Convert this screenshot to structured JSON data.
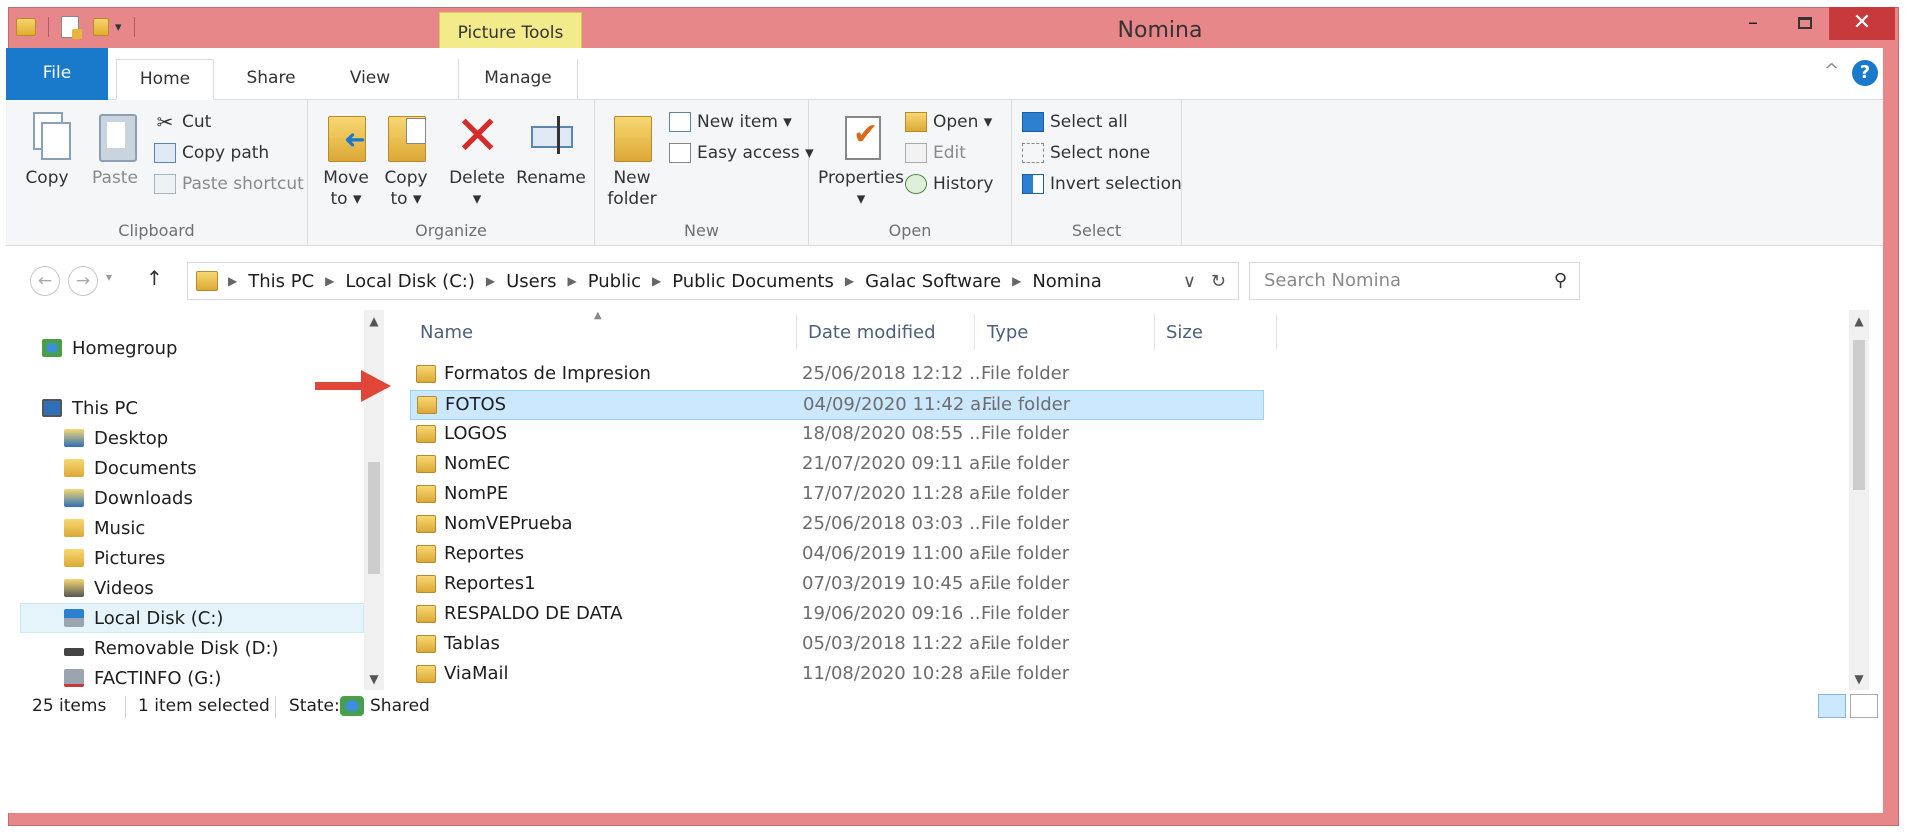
{
  "window": {
    "title": "Nomina",
    "context_tab": "Picture Tools",
    "controls": {
      "minimize": "–",
      "maximize": "□",
      "close": "✕"
    }
  },
  "ribbon": {
    "tabs": [
      "File",
      "Home",
      "Share",
      "View",
      "Manage"
    ],
    "active_tab": "Home",
    "help": "?",
    "collapse": "^",
    "groups": {
      "clipboard": {
        "label": "Clipboard",
        "copy": "Copy",
        "paste": "Paste",
        "cut": "Cut",
        "copy_path": "Copy path",
        "paste_shortcut": "Paste shortcut"
      },
      "organize": {
        "label": "Organize",
        "move_to": [
          "Move",
          "to ▾"
        ],
        "copy_to": [
          "Copy",
          "to ▾"
        ],
        "delete": "Delete",
        "delete_caret": "▾",
        "rename": "Rename"
      },
      "new": {
        "label": "New",
        "new_folder": [
          "New",
          "folder"
        ],
        "new_item": "New item ▾",
        "easy_access": "Easy access ▾"
      },
      "open": {
        "label": "Open",
        "properties": "Properties",
        "properties_caret": "▾",
        "open": "Open ▾",
        "edit": "Edit",
        "history": "History"
      },
      "select": {
        "label": "Select",
        "select_all": "Select all",
        "select_none": "Select none",
        "invert_selection": "Invert selection"
      }
    }
  },
  "address": {
    "back": "←",
    "forward": "→",
    "recent": "▾",
    "up": "↑",
    "crumbs": [
      "This PC",
      "Local Disk (C:)",
      "Users",
      "Public",
      "Public Documents",
      "Galac Software",
      "Nomina"
    ],
    "separator": "▶",
    "dropdown": "∨",
    "refresh": "↻",
    "search_placeholder": "Search Nomina",
    "search_icon": "⚲"
  },
  "nav_pane": {
    "items": [
      {
        "label": "Homegroup",
        "icon": "homegroup-icon"
      },
      {
        "label": "This PC",
        "icon": "computer-icon"
      },
      {
        "label": "Desktop",
        "icon": "desktop-icon"
      },
      {
        "label": "Documents",
        "icon": "documents-icon"
      },
      {
        "label": "Downloads",
        "icon": "downloads-icon"
      },
      {
        "label": "Music",
        "icon": "music-icon"
      },
      {
        "label": "Pictures",
        "icon": "pictures-icon"
      },
      {
        "label": "Videos",
        "icon": "videos-icon"
      },
      {
        "label": "Local Disk (C:)",
        "icon": "drive-icon"
      },
      {
        "label": "Removable Disk (D:)",
        "icon": "removable-drive-icon"
      },
      {
        "label": "FACTINFO (G:)",
        "icon": "network-drive-icon"
      }
    ],
    "selected": "Local Disk (C:)"
  },
  "file_list": {
    "columns": {
      "name": "Name",
      "date": "Date modified",
      "type": "Type",
      "size": "Size"
    },
    "sort_indicator": "▲",
    "rows": [
      {
        "name": "Formatos de Impresion",
        "date": "25/06/2018 12:12 ...",
        "type": "File folder"
      },
      {
        "name": "FOTOS",
        "date": "04/09/2020 11:42 a...",
        "type": "File folder"
      },
      {
        "name": "LOGOS",
        "date": "18/08/2020 08:55 ...",
        "type": "File folder"
      },
      {
        "name": "NomEC",
        "date": "21/07/2020 09:11 a...",
        "type": "File folder"
      },
      {
        "name": "NomPE",
        "date": "17/07/2020 11:28 a...",
        "type": "File folder"
      },
      {
        "name": "NomVEPrueba",
        "date": "25/06/2018 03:03 ...",
        "type": "File folder"
      },
      {
        "name": "Reportes",
        "date": "04/06/2019 11:00 a...",
        "type": "File folder"
      },
      {
        "name": "Reportes1",
        "date": "07/03/2019 10:45 a...",
        "type": "File folder"
      },
      {
        "name": "RESPALDO DE DATA",
        "date": "19/06/2020 09:16 ...",
        "type": "File folder"
      },
      {
        "name": "Tablas",
        "date": "05/03/2018 11:22 a...",
        "type": "File folder"
      },
      {
        "name": "ViaMail",
        "date": "11/08/2020 10:28 a...",
        "type": "File folder"
      }
    ],
    "selected_row": "FOTOS"
  },
  "status_bar": {
    "items": "25 items",
    "selected": "1 item selected",
    "state_label": "State:",
    "state_value": "Shared"
  },
  "colors": {
    "frame": "#e8878a",
    "close_button": "#c7393b",
    "file_tab": "#1979ca",
    "picture_tools": "#f3ea8a",
    "selection": "#cce8ff",
    "annotation_arrow": "#e0453a"
  }
}
